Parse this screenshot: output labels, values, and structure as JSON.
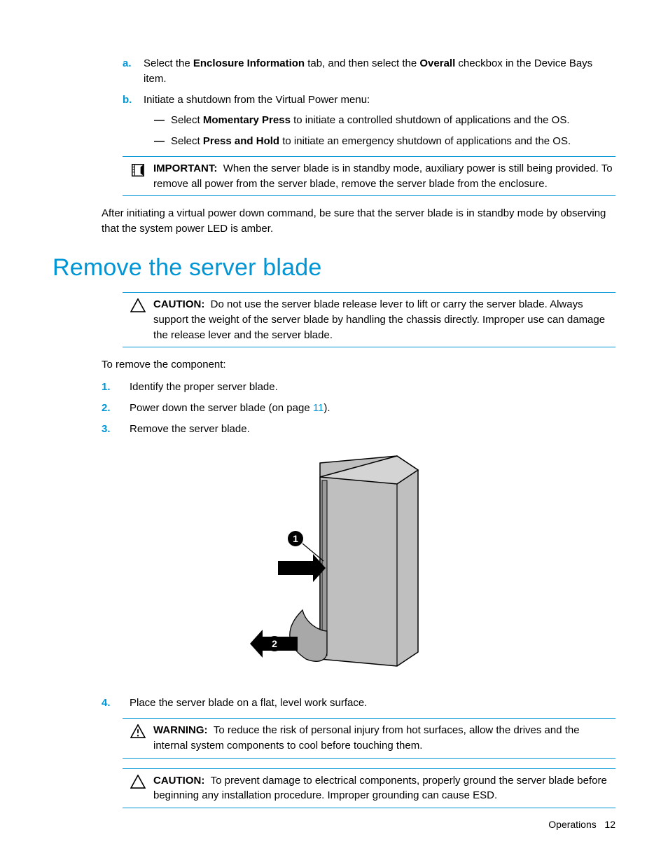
{
  "sub_a": {
    "marker": "a.",
    "t1": "Select the ",
    "b1": "Enclosure Information",
    "t2": " tab, and then select the ",
    "b2": "Overall",
    "t3": " checkbox in the Device Bays item."
  },
  "sub_b": {
    "marker": "b.",
    "text": "Initiate a shutdown from the Virtual Power menu:"
  },
  "dash1": {
    "marker": "—",
    "t1": "Select ",
    "b1": "Momentary Press",
    "t2": " to initiate a controlled shutdown of applications and the OS."
  },
  "dash2": {
    "marker": "—",
    "t1": "Select ",
    "b1": "Press and Hold",
    "t2": " to initiate an emergency shutdown of applications and the OS."
  },
  "important": {
    "label": "IMPORTANT:",
    "text": "When the server blade is in standby mode, auxiliary power is still being provided. To remove all power from the server blade, remove the server blade from the enclosure."
  },
  "para_after": "After initiating a virtual power down command, be sure that the server blade is in standby mode by observing that the system power LED is amber.",
  "heading": "Remove the server blade",
  "caution1": {
    "label": "CAUTION:",
    "text": "Do not use the server blade release lever to lift or carry the server blade. Always support the weight of the server blade by handling the chassis directly. Improper use can damage the release lever and the server blade."
  },
  "intro": "To remove the component:",
  "step1": {
    "marker": "1.",
    "text": "Identify the proper server blade."
  },
  "step2": {
    "marker": "2.",
    "t1": "Power down the server blade (on page ",
    "link": "11",
    "t2": ")."
  },
  "step3": {
    "marker": "3.",
    "text": "Remove the server blade."
  },
  "step4": {
    "marker": "4.",
    "text": "Place the server blade on a flat, level work surface."
  },
  "warning": {
    "label": "WARNING:",
    "text": "To reduce the risk of personal injury from hot surfaces, allow the drives and the internal system components to cool before touching them."
  },
  "caution2": {
    "label": "CAUTION:",
    "text": "To prevent damage to electrical components, properly ground the server blade before beginning any installation procedure. Improper grounding can cause ESD."
  },
  "footer": {
    "section": "Operations",
    "page": "12"
  }
}
